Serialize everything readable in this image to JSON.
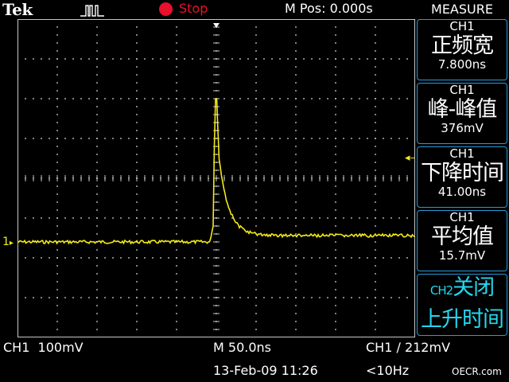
{
  "header": {
    "logo": "Tek",
    "acquisition_icon": "pulse-acquisition-icon",
    "run_status": "Stop",
    "status_color": "#e8102a",
    "m_pos": "M Pos: 0.000s"
  },
  "menu": {
    "title": "MEASURE",
    "items": [
      {
        "channel": "CH1",
        "name": "正频宽",
        "value": "7.800ns"
      },
      {
        "channel": "CH1",
        "name": "峰-峰值",
        "value": "376mV"
      },
      {
        "channel": "CH1",
        "name": "下降时间",
        "value": "41.00ns"
      },
      {
        "channel": "CH1",
        "name": "平均值",
        "value": "15.7mV"
      }
    ],
    "ch2_prefix": "CH2",
    "ch2_text": "关闭",
    "last_line": "上升时间"
  },
  "status_bar": {
    "ch1_scale": "CH1  100mV",
    "timebase": "M 50.0ns",
    "trigger": "CH1 ∕ 212mV",
    "datetime": "13-Feb-09 11:26",
    "freq": "<10Hz",
    "watermark": "OECR.com"
  },
  "colors": {
    "trace": "#f2ea1a",
    "grid": "#c8c8c8",
    "menu_border": "#2a9ad8",
    "cyan_text": "#23d7f0"
  },
  "scope": {
    "trigger_marker": "trigger-position-marker",
    "ch1_marker": "1",
    "trigger_level_marker": "trigger-level-marker"
  }
}
